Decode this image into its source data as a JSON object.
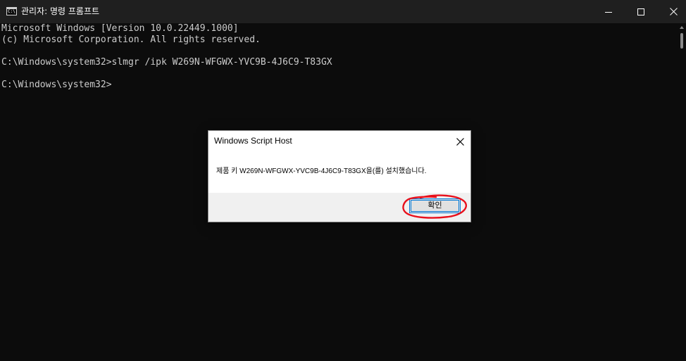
{
  "window": {
    "title": "관리자: 명령 프롬프트",
    "icon_text": "C:\\"
  },
  "icons": {
    "app": "console-app-icon",
    "minimize": "minimize-icon",
    "maximize": "maximize-icon",
    "close": "close-icon",
    "dialog_close": "close-icon",
    "scroll_up": "scroll-up-arrow-icon"
  },
  "console": {
    "lines": [
      "Microsoft Windows [Version 10.0.22449.1000]",
      "(c) Microsoft Corporation. All rights reserved.",
      "",
      "C:\\Windows\\system32>slmgr /ipk W269N-WFGWX-YVC9B-4J6C9-T83GX",
      "",
      "C:\\Windows\\system32>"
    ]
  },
  "dialog": {
    "title": "Windows Script Host",
    "message": "제품 키 W269N-WFGWX-YVC9B-4J6C9-T83GX을(를) 설치했습니다.",
    "ok_label": "확인"
  },
  "colors": {
    "console_bg": "#0c0c0c",
    "titlebar_bg": "#1f1f1f",
    "console_text": "#cccccc",
    "dialog_bg": "#ffffff",
    "dialog_footer_bg": "#f0f0f0",
    "ok_border": "#0078d7",
    "annotation": "#e8101c"
  }
}
